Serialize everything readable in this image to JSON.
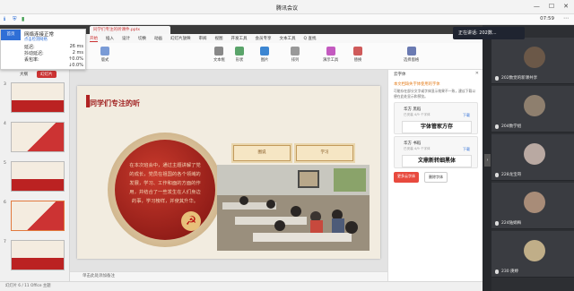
{
  "window": {
    "title": "腾讯会议"
  },
  "meeting": {
    "time": "07:59"
  },
  "network": {
    "status": "网络连接正常",
    "detail_link": "点击检测网络",
    "rows": [
      {
        "label": "延迟:",
        "value": "26 ms"
      },
      {
        "label": "抖动延迟:",
        "value": "2 ms"
      },
      {
        "label": "丢包率:",
        "value": "↑0.0%"
      },
      {
        "label": "",
        "value": "↓0.0%"
      }
    ],
    "tab_label": "首页"
  },
  "wps": {
    "tab_title": "同学们专注的听课件.pptx",
    "speaking": "正在讲话: 202数...",
    "menu": [
      "开始",
      "插入",
      "设计",
      "切换",
      "动画",
      "幻灯片放映",
      "审阅",
      "视图",
      "开发工具",
      "会员专享",
      "文本工具",
      "Q 查找"
    ],
    "active_menu": "开始",
    "ribbon": [
      {
        "label": "粘贴",
        "color": "#d9a441"
      },
      {
        "label": "新建幻灯片",
        "color": "#e26a3c"
      },
      {
        "label": "版式",
        "color": "#7a9bd6"
      },
      {
        "label": "文本框",
        "color": "#888888"
      },
      {
        "label": "形状",
        "color": "#5aa46a"
      },
      {
        "label": "图片",
        "color": "#3c86d2"
      },
      {
        "label": "排列",
        "color": "#999999"
      },
      {
        "label": "演示工具",
        "color": "#c45ac0"
      },
      {
        "label": "替换",
        "color": "#cf5a5a"
      },
      {
        "label": "选择窗格",
        "color": "#6a7ab2"
      }
    ],
    "left_tabs": [
      "大纲",
      "幻灯片"
    ],
    "slides": [
      {
        "num": "3"
      },
      {
        "num": "4"
      },
      {
        "num": "5"
      },
      {
        "num": "6"
      },
      {
        "num": "7"
      }
    ],
    "slide": {
      "title": "同学们专注的听",
      "body": "在本次班会中，通过主题讲解了党的成长，党员在祖国的各个领域的发展，学习、工作和面的方面的作用，并结合了一些发生在人们身边的事，学习榜样，并使其升华。",
      "plaque1": "图说",
      "plaque2": "学习",
      "emblem": "☭"
    },
    "note_placeholder": "单击此处添加备注",
    "status": "幻灯片 6 / 11   Office 主题",
    "right_panel": {
      "header": "云字体",
      "warning": "本文档缺失字体使用的字体",
      "description": "可能存在部分文字或字体显示效果不一致，建议下载以便在此处显示和预览。",
      "fonts": [
        {
          "name": "华方 黑稻",
          "sub": "已安装 4/9 个字体",
          "action": "下载",
          "preview": "字体管家方存"
        },
        {
          "name": "华方 书稻",
          "sub": "已安装 4/9 个字体",
          "action": "下载",
          "preview": "文鼎新转细黑体"
        }
      ],
      "btn_primary": "更多云字体",
      "btn_secondary": "删除字体"
    }
  },
  "participants": [
    {
      "name": "202数觉的新课共享"
    },
    {
      "name": "204数学组"
    },
    {
      "name": "228龙宝哥"
    },
    {
      "name": "224陆娟梅"
    },
    {
      "name": "230 庚婷"
    }
  ],
  "colors": {
    "accent": "#c33",
    "meeting_bg": "#2d2f33"
  }
}
